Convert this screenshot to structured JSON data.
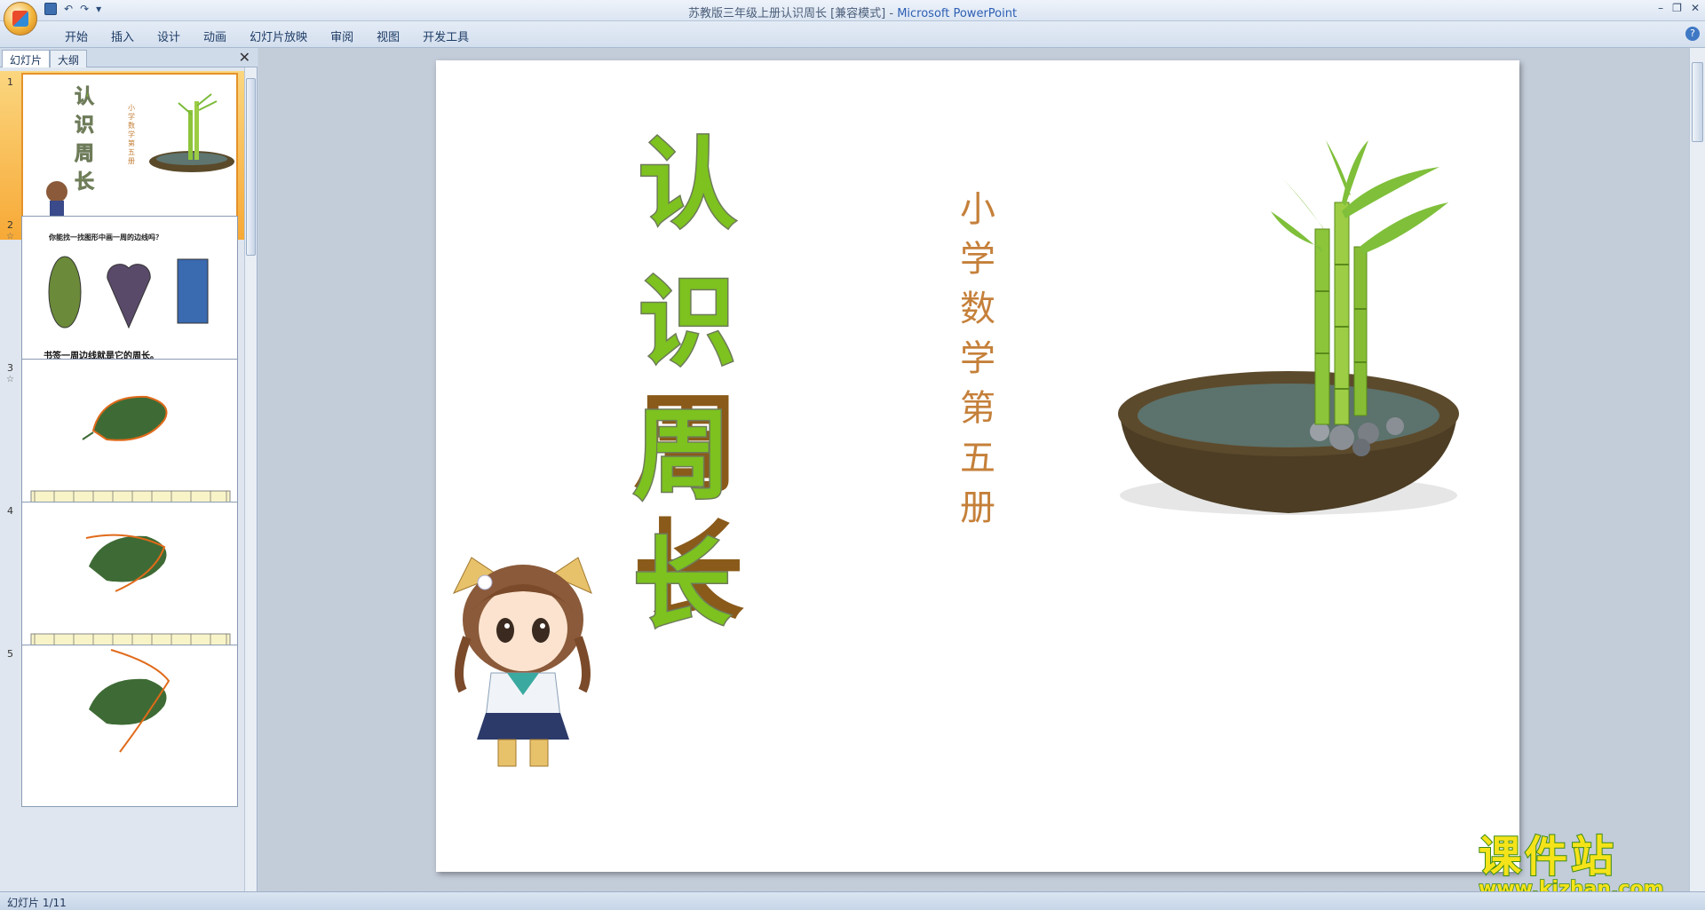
{
  "window": {
    "title": "苏教版三年级上册认识周长 [兼容模式]",
    "title_sep": " - ",
    "app_name": "Microsoft PowerPoint"
  },
  "ribbon": {
    "tabs": [
      "开始",
      "插入",
      "设计",
      "动画",
      "幻灯片放映",
      "审阅",
      "视图",
      "开发工具"
    ]
  },
  "left_pane": {
    "tab_slides": "幻灯片",
    "tab_outline": "大纲",
    "close": "✕"
  },
  "thumbnails": [
    {
      "num": "1",
      "title_chars": [
        "认",
        "识",
        "周",
        "长"
      ],
      "subtitle": "小学数学第五册"
    },
    {
      "num": "2",
      "question": "你能找一找图形中画一周的边线吗？",
      "caption": "书签一周边线就是它的周长。"
    },
    {
      "num": "3"
    },
    {
      "num": "4"
    },
    {
      "num": "5"
    }
  ],
  "slide": {
    "title_chars": [
      "认",
      "识",
      "周",
      "长"
    ],
    "subtitle_chars": [
      "小",
      "学",
      "数",
      "学",
      "第",
      "五",
      "册"
    ]
  },
  "status": {
    "slide_counter": "幻灯片 1/11"
  },
  "watermark": {
    "title": "课件站",
    "url": "www.kjzhan.com"
  },
  "colors": {
    "title_green": "#7dc21e",
    "subtitle_orange": "#c5803a",
    "selection_orange": "#f7a936"
  }
}
